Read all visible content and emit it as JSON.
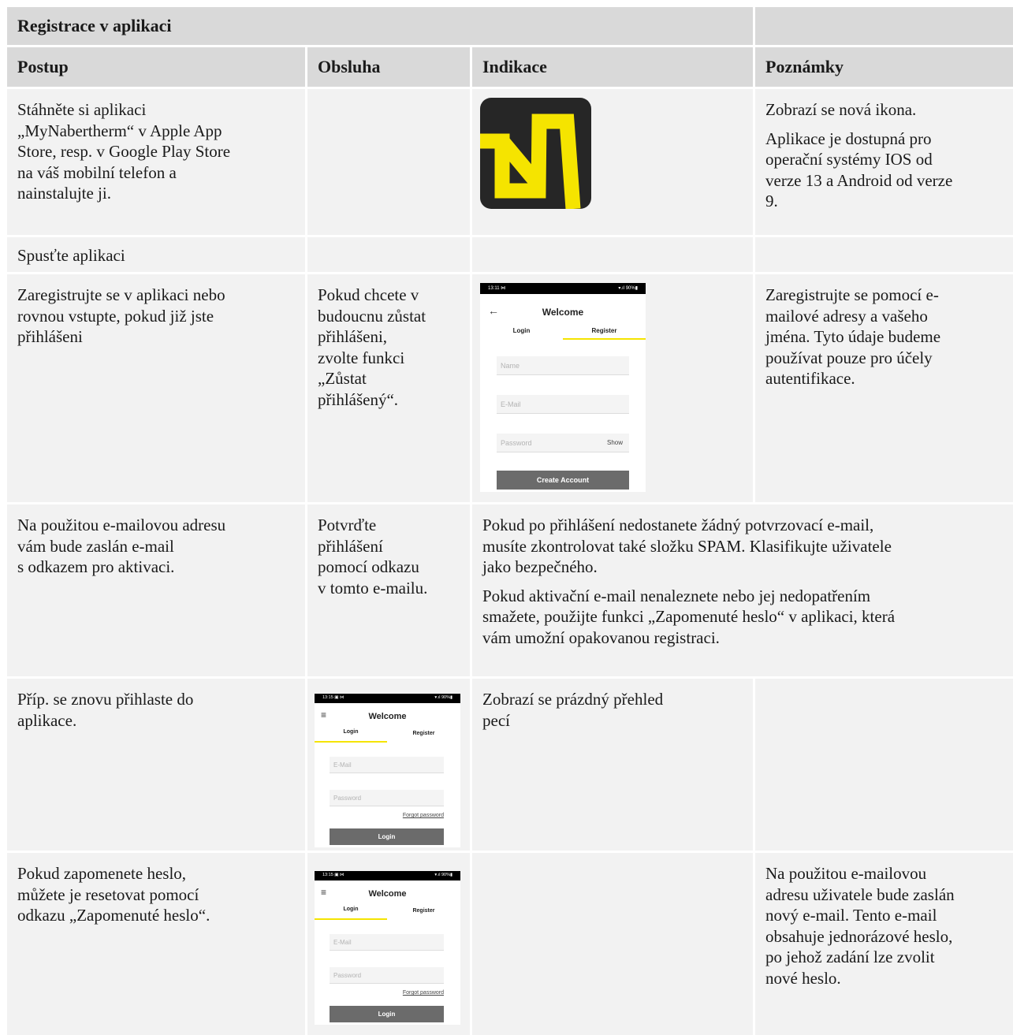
{
  "section_title": "Registrace v aplikaci",
  "columns": [
    "Postup",
    "Obsluha",
    "Indikace",
    "Poznámky"
  ],
  "rows": [
    {
      "postup": [
        "Stáhněte si aplikaci",
        "„MyNabertherm“ v Apple App",
        "Store, resp. v Google Play Store",
        "na váš mobilní telefon a",
        "nainstalujte ji."
      ],
      "obsluha": [],
      "indikace": "app-icon",
      "poznamky": [
        [
          "Zobrazí se nová ikona."
        ],
        [
          "Aplikace je dostupná pro",
          "operační systémy IOS od",
          "verze 13 a Android od verze",
          "9."
        ]
      ]
    },
    {
      "postup": [
        "Spusťte aplikaci"
      ]
    },
    {
      "postup": [
        "Zaregistrujte se v aplikaci nebo",
        "rovnou vstupte, pokud již jste",
        "přihlášeni"
      ],
      "obsluha": [
        "Pokud chcete v",
        "budoucnu zůstat",
        "přihlášeni,",
        "zvolte funkci",
        "„Zůstat",
        "přihlášený“."
      ],
      "poznamky": [
        "Zaregistrujte se pomocí e-",
        "mailové adresy a vašeho",
        "jména. Tyto údaje budeme",
        "používat pouze pro účely",
        "autentifikace."
      ]
    },
    {
      "postup": [
        "Na použitou e-mailovou adresu",
        "vám bude zaslán e-mail",
        "s odkazem pro aktivaci."
      ],
      "obsluha": [
        "Potvrďte",
        "přihlášení",
        "pomocí odkazu",
        "v tomto e-mailu."
      ],
      "note": [
        [
          "Pokud po přihlášení nedostanete žádný potvrzovací e-mail,",
          "musíte zkontrolovat také složku SPAM. Klasifikujte uživatele",
          "jako bezpečného."
        ],
        [
          "Pokud aktivační e-mail nenaleznete nebo jej nedopatřením",
          "smažete, použijte funkci „Zapomenuté heslo“ v aplikaci, která",
          "vám umožní opakovanou registraci."
        ]
      ]
    },
    {
      "postup": [
        "Příp. se znovu přihlaste do",
        "aplikace."
      ],
      "indikace": [
        "Zobrazí se prázdný přehled",
        "pecí"
      ]
    },
    {
      "postup": [
        "Pokud zapomenete heslo,",
        "můžete je resetovat pomocí",
        "odkazu „Zapomenuté heslo“."
      ],
      "poznamky": [
        "Na použitou e-mailovou",
        "adresu uživatele bude zaslán",
        "nový e-mail. Tento e-mail",
        "obsahuje jednorázové heslo,",
        "po jehož zadání lze zvolit",
        "nové heslo."
      ]
    }
  ],
  "screens": {
    "register": {
      "time": "13:11 ⋈",
      "status_right": "▾.ıl 90%▮",
      "back_glyph": "←",
      "title": "Welcome",
      "tab_login": "Login",
      "tab_register": "Register",
      "name_placeholder": "Name",
      "email_placeholder": "E-Mail",
      "password_placeholder": "Password",
      "show": "Show",
      "button": "Create Account"
    },
    "login": {
      "time": "13:15 ▣ ⋈",
      "status_right": "▾.ıl 90%▮",
      "menu_glyph": "≡",
      "title": "Welcome",
      "tab_login": "Login",
      "tab_register": "Register",
      "email_placeholder": "E-Mail",
      "password_placeholder": "Password",
      "forgot": "Forgot password",
      "button": "Login"
    }
  },
  "colors": {
    "header_bg": "#d9d9d9",
    "cell_bg": "#f2f2f2",
    "accent_yellow": "#f5e400",
    "icon_bg": "#262626",
    "button_bg": "#6b6b6b"
  }
}
